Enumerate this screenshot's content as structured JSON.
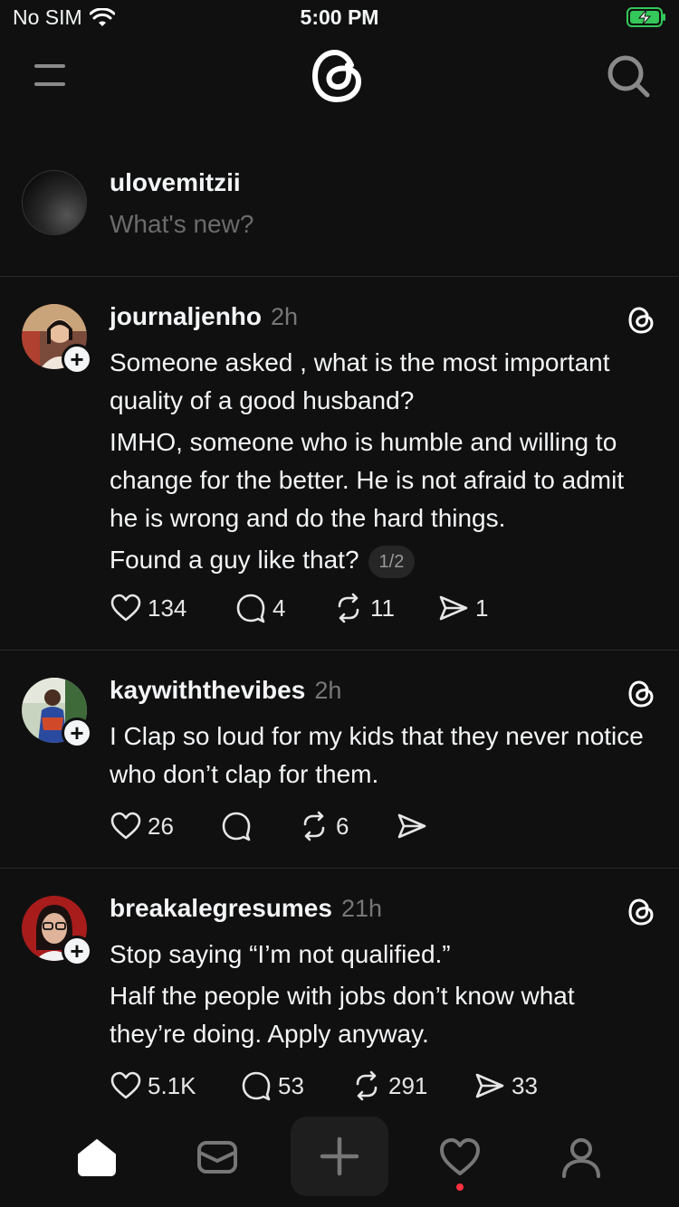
{
  "status_bar": {
    "carrier": "No SIM",
    "time": "5:00 PM"
  },
  "composer": {
    "username": "ulovemitzii",
    "placeholder": "What's new?"
  },
  "posts": [
    {
      "handle": "journaljenho",
      "time": "2h",
      "paragraphs": [
        "Someone asked , what is the most important quality of a good husband?",
        "IMHO, someone who is humble and willing to change for the better. He is not afraid to admit he is wrong and do the hard things.",
        "Found a guy like that?"
      ],
      "page_indicator": "1/2",
      "likes": "134",
      "replies": "4",
      "reposts": "11",
      "shares": "1"
    },
    {
      "handle": "kaywiththevibes",
      "time": "2h",
      "paragraphs": [
        "I Clap so loud for my kids that they never notice who don’t clap for them."
      ],
      "likes": "26",
      "replies": "",
      "reposts": "6",
      "shares": ""
    },
    {
      "handle": "breakalegresumes",
      "time": "21h",
      "paragraphs": [
        "Stop saying “I’m not qualified.”",
        "Half the people with jobs don’t know what they’re doing. Apply anyway."
      ],
      "likes": "5.1K",
      "replies": "53",
      "reposts": "291",
      "shares": "33"
    }
  ],
  "tabbar": {
    "items": [
      "home",
      "inbox",
      "create",
      "activity",
      "profile"
    ],
    "active": "home",
    "notification_dot_color": "#ff3040"
  },
  "colors": {
    "background": "#101010",
    "text": "#f3f5f7",
    "secondary_text": "#777777",
    "battery": "#34c759"
  }
}
